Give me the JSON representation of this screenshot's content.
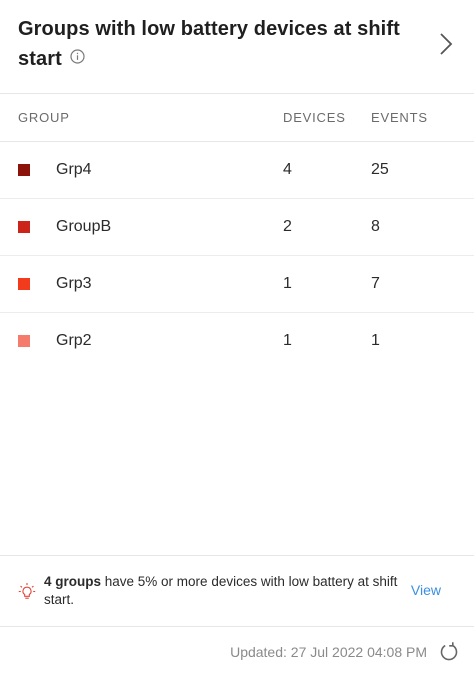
{
  "header": {
    "title": "Groups with low battery devices at shift start"
  },
  "table": {
    "columns": {
      "group": "GROUP",
      "devices": "DEVICES",
      "events": "EVENTS"
    },
    "rows": [
      {
        "group": "Grp4",
        "devices": "4",
        "events": "25",
        "color": "#8b1309"
      },
      {
        "group": "GroupB",
        "devices": "2",
        "events": "8",
        "color": "#cc2418"
      },
      {
        "group": "Grp3",
        "devices": "1",
        "events": "7",
        "color": "#f23a1c"
      },
      {
        "group": "Grp2",
        "devices": "1",
        "events": "1",
        "color": "#f57b6d"
      }
    ]
  },
  "insight": {
    "count_bold": "4 groups",
    "message": " have 5% or more devices with low battery at shift start.",
    "view_label": "View",
    "accent_color": "#e2473a"
  },
  "footer": {
    "updated": "Updated: 27 Jul 2022 04:08 PM"
  },
  "colors": {
    "link": "#3b8fe0",
    "divider": "#e6e6e6"
  }
}
